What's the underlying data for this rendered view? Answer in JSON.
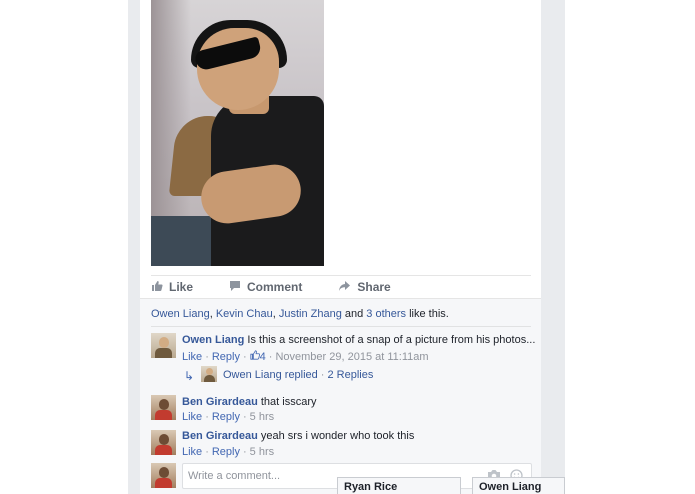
{
  "post": {
    "actions": {
      "like": "Like",
      "comment": "Comment",
      "share": "Share"
    }
  },
  "likes": {
    "names": [
      "Owen Liang",
      "Kevin Chau",
      "Justin Zhang"
    ],
    "sep1": ", ",
    "sep2": ", ",
    "and": " and ",
    "others": "3 others",
    "suffix": " like this."
  },
  "comments": [
    {
      "author": "Owen Liang",
      "text": " Is this a screenshot of a snap of a picture from his photos...",
      "like": "Like",
      "reply": "Reply",
      "like_count": "4",
      "time": "November 29, 2015 at 11:11am",
      "replies_summary": {
        "author": "Owen Liang",
        "replied": " replied",
        "count": "2 Replies"
      }
    },
    {
      "author": "Ben Girardeau",
      "text": " that isscary",
      "like": "Like",
      "reply": "Reply",
      "time": "5 hrs"
    },
    {
      "author": "Ben Girardeau",
      "text": " yeah srs i wonder who took this",
      "like": "Like",
      "reply": "Reply",
      "time": "5 hrs"
    }
  ],
  "composer": {
    "placeholder": "Write a comment..."
  },
  "chat_tabs": [
    "Ryan Rice",
    "Owen Liang"
  ],
  "colors": {
    "link": "#365899",
    "meta": "#90949c",
    "background": "#e9ebee"
  },
  "icons": [
    "thumbs-up-icon",
    "comment-icon",
    "share-icon",
    "reply-arrow-icon",
    "camera-icon",
    "smiley-icon"
  ]
}
